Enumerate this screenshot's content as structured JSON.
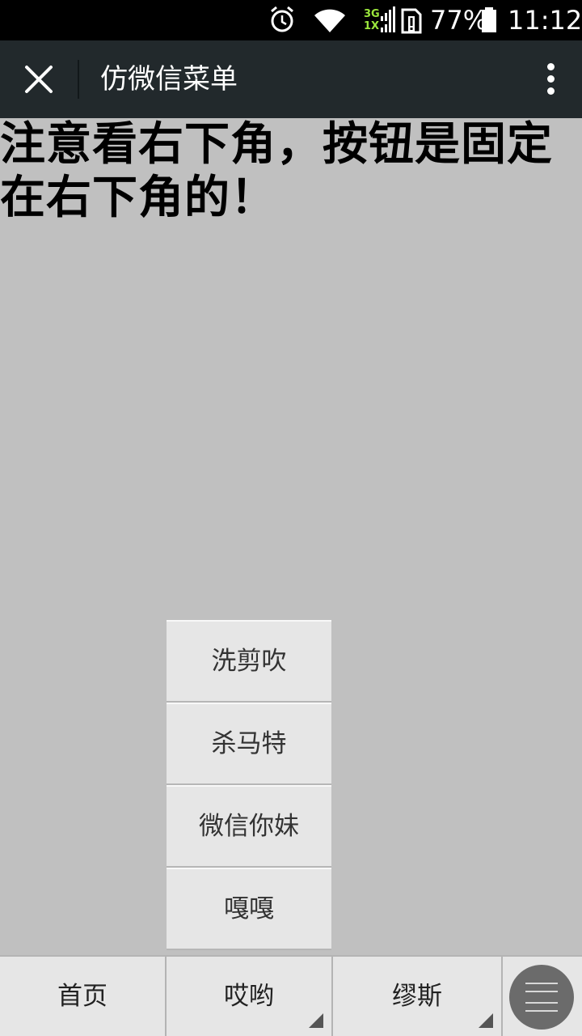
{
  "status_bar": {
    "network": "3G",
    "network2": "1X",
    "battery": "77%",
    "time": "11:12",
    "icons": [
      "alarm-icon",
      "wifi-icon",
      "signal-icon",
      "sim-alert-icon",
      "battery-icon"
    ]
  },
  "title_bar": {
    "title": "仿微信菜单",
    "close_icon": "close-icon",
    "more_icon": "more-vertical-icon"
  },
  "content": {
    "headline": "注意看右下角，按钮是固定在右下角的！"
  },
  "submenu": {
    "items": [
      {
        "label": "洗剪吹"
      },
      {
        "label": "杀马特"
      },
      {
        "label": "微信你妹"
      },
      {
        "label": "嘎嘎"
      }
    ]
  },
  "bottom_menu": {
    "items": [
      {
        "label": "首页",
        "has_submenu": false
      },
      {
        "label": "哎哟",
        "has_submenu": true
      },
      {
        "label": "缪斯",
        "has_submenu": true
      }
    ],
    "menu_button_icon": "hamburger-icon"
  },
  "colors": {
    "title_bar_bg": "#22292c",
    "content_bg": "#c0c0c0",
    "menu_bg": "#e6e6e6",
    "fab_bg": "#6b6b6b"
  }
}
